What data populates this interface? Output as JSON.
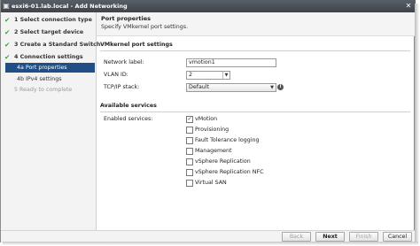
{
  "window": {
    "title": "esxi6-01.lab.local - Add Networking"
  },
  "steps": [
    {
      "label": "1  Select connection type",
      "state": "done"
    },
    {
      "label": "2  Select target device",
      "state": "done"
    },
    {
      "label": "3  Create a Standard Switch",
      "state": "done"
    },
    {
      "label": "4  Connection settings",
      "state": "done"
    },
    {
      "label": "4a  Port properties",
      "state": "active"
    },
    {
      "label": "4b  IPv4 settings",
      "state": "pending"
    },
    {
      "label": "5  Ready to complete",
      "state": "disabled"
    }
  ],
  "header": {
    "title": "Port properties",
    "subtitle": "Specify VMkernel port settings."
  },
  "port_settings": {
    "section_title": "VMkernel port settings",
    "network_label": {
      "label": "Network label:",
      "value": "vmotion1"
    },
    "vlan_id": {
      "label": "VLAN ID:",
      "value": "2"
    },
    "tcpip_stack": {
      "label": "TCP/IP stack:",
      "value": "Default"
    }
  },
  "services": {
    "section_title": "Available services",
    "label": "Enabled services:",
    "items": [
      {
        "label": "vMotion",
        "checked": true
      },
      {
        "label": "Provisioning",
        "checked": false
      },
      {
        "label": "Fault Tolerance logging",
        "checked": false
      },
      {
        "label": "Management",
        "checked": false
      },
      {
        "label": "vSphere Replication",
        "checked": false
      },
      {
        "label": "vSphere Replication NFC",
        "checked": false
      },
      {
        "label": "Virtual SAN",
        "checked": false
      }
    ]
  },
  "footer": {
    "back": "Back",
    "next": "Next",
    "finish": "Finish",
    "cancel": "Cancel"
  },
  "colors": {
    "active_step": "#1f4f85",
    "check": "#3aa03a",
    "titlebar": "#4a4f57"
  }
}
